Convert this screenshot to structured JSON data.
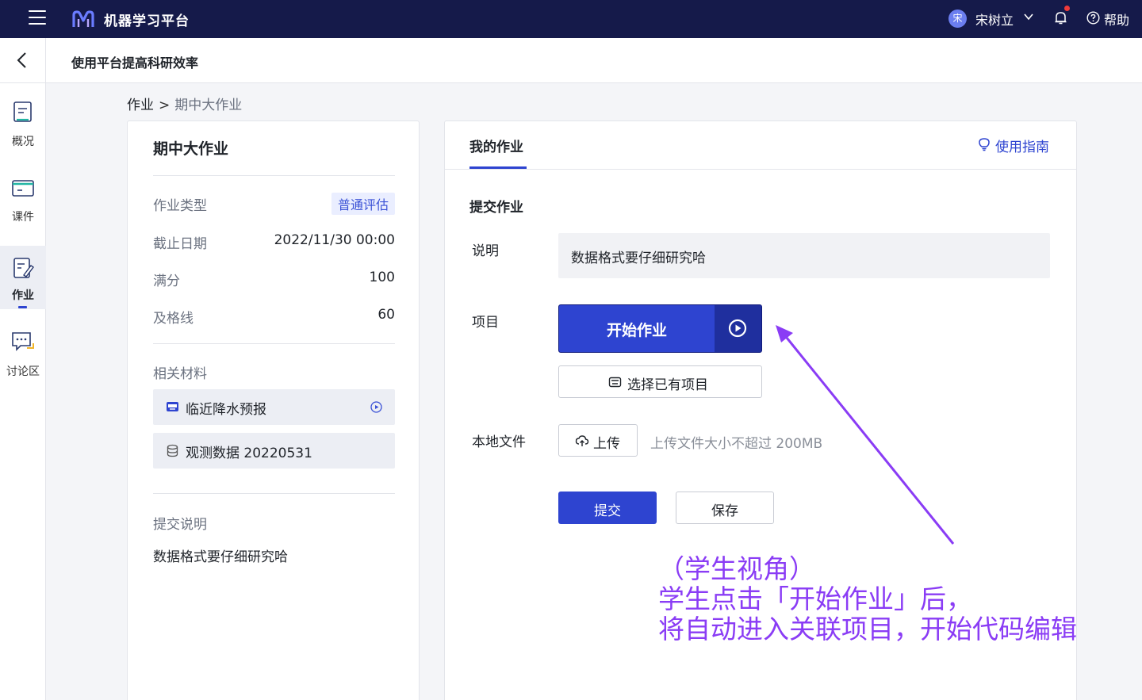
{
  "topbar": {
    "app_name": "机器学习平台",
    "avatar_char": "宋",
    "user_name": "宋树立",
    "help": "帮助",
    "logo_icon": "m-logo-icon",
    "menu_icon": "hamburger-menu-icon",
    "bell_icon": "bell-icon",
    "help_icon": "question-circle-icon"
  },
  "subheader": {
    "title": "使用平台提高科研效率"
  },
  "leftnav": {
    "items": [
      {
        "label": "概况",
        "icon": "overview-icon"
      },
      {
        "label": "课件",
        "icon": "courseware-icon"
      },
      {
        "label": "作业",
        "icon": "assignment-icon",
        "active": true
      },
      {
        "label": "讨论区",
        "icon": "discussion-icon"
      }
    ]
  },
  "breadcrumb": {
    "root": "作业",
    "sep": ">",
    "current": "期中大作业"
  },
  "assignment": {
    "title": "期中大作业",
    "fields": [
      {
        "key": "作业类型",
        "value": "普通评估"
      },
      {
        "key": "截止日期",
        "value": "2022/11/30 00:00"
      },
      {
        "key": "满分",
        "value": "100"
      },
      {
        "key": "及格线",
        "value": "60"
      }
    ],
    "materials_label": "相关材料",
    "materials": [
      {
        "name": "临近降水预报",
        "icon": "project-icon"
      },
      {
        "name": "观测数据 20220531",
        "icon": "database-icon"
      }
    ],
    "submit_desc_label": "提交说明",
    "submit_desc": "数据格式要仔细研究哈"
  },
  "my_work": {
    "tab": "我的作业",
    "guide": "使用指南",
    "section_title": "提交作业",
    "desc_label": "说明",
    "desc_value": "数据格式要仔细研究哈",
    "project_label": "项目",
    "start_btn": "开始作业",
    "select_btn": "选择已有项目",
    "file_label": "本地文件",
    "upload_btn": "上传",
    "upload_hint": "上传文件大小不超过 200MB",
    "submit_btn": "提交",
    "save_btn": "保存"
  },
  "annotation": {
    "line1": "（学生视角）",
    "line2": "学生点击「开始作业」后，",
    "line3": "将自动进入关联项目，开始代码编辑"
  },
  "colors": {
    "topbar_bg": "#151a4a",
    "primary": "#2e44d0",
    "annotation": "#8a3cf5"
  }
}
